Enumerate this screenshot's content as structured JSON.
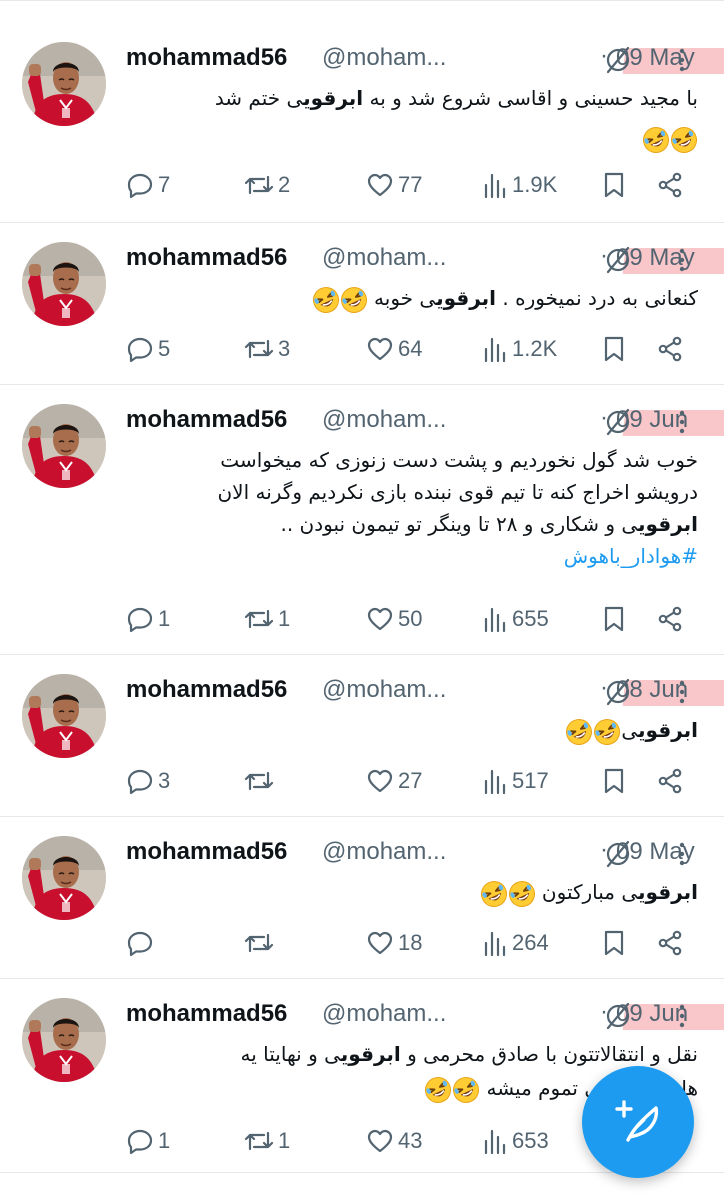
{
  "colors": {
    "accent": "#1d9bf0",
    "text": "#0f1419",
    "muted": "#536471",
    "highlight": "#f7b4b8"
  },
  "tweets": [
    {
      "name": "mohammad56",
      "handle": "@moham...",
      "date": "09 May",
      "highlighted": true,
      "lines": [
        {
          "parts": [
            {
              "t": "با مجید حسینی و اقاسی شروع شد و به "
            },
            {
              "t": "ابرقوی",
              "b": true
            },
            {
              "t": "ی ختم شد"
            }
          ]
        },
        {
          "parts": [],
          "emojis": 2
        }
      ],
      "replies": "7",
      "reposts": "2",
      "likes": "77",
      "views": "1.9K"
    },
    {
      "name": "mohammad56",
      "handle": "@moham...",
      "date": "09 May",
      "highlighted": true,
      "lines": [
        {
          "parts": [
            {
              "t": "کنعانی به درد نمیخوره . "
            },
            {
              "t": "ابرقوی",
              "b": true
            },
            {
              "t": "ی خوبه "
            }
          ],
          "emojis": 2
        }
      ],
      "replies": "5",
      "reposts": "3",
      "likes": "64",
      "views": "1.2K"
    },
    {
      "name": "mohammad56",
      "handle": "@moham...",
      "date": "09 Jun",
      "highlighted": true,
      "lines": [
        {
          "parts": [
            {
              "t": "خوب شد گول نخوردیم و پشت دست زنوزی که میخواست"
            }
          ]
        },
        {
          "parts": [
            {
              "t": "درویشو اخراج کنه تا تیم قوی نبنده بازی نکردیم وگرنه الان"
            }
          ]
        },
        {
          "parts": [
            {
              "t": "ابرقوی",
              "b": true
            },
            {
              "t": "ی و شکاری و ۲۸ تا وینگر تو تیمون نبودن .."
            }
          ]
        }
      ],
      "hashtag": "#هوادار_باهوش",
      "replies": "1",
      "reposts": "1",
      "likes": "50",
      "views": "655"
    },
    {
      "name": "mohammad56",
      "handle": "@moham...",
      "date": "08 Jun",
      "highlighted": true,
      "lines": [
        {
          "parts": [
            {
              "t": "ابرقوی",
              "b": true
            },
            {
              "t": "ی"
            }
          ],
          "emojis": 2
        }
      ],
      "replies": "3",
      "reposts": "",
      "likes": "27",
      "views": "517"
    },
    {
      "name": "mohammad56",
      "handle": "@moham...",
      "date": "09 May",
      "highlighted": false,
      "lines": [
        {
          "parts": [
            {
              "t": "ابرقوی",
              "b": true
            },
            {
              "t": "ی مبارکتون "
            }
          ],
          "emojis": 2
        }
      ],
      "replies": "",
      "reposts": "",
      "likes": "18",
      "views": "264"
    },
    {
      "name": "mohammad56",
      "handle": "@moham...",
      "date": "09 Jun",
      "highlighted": true,
      "lines": [
        {
          "parts": [
            {
              "t": "نقل و انتقالاتتون با صادق محرمی و "
            },
            {
              "t": "ابرقوی",
              "b": true
            },
            {
              "t": "ی و نهایتا یه"
            }
          ]
        },
        {
          "parts": [
            {
              "t": "هافبک خارجی تموم میشه "
            }
          ],
          "emojis": 2
        }
      ],
      "replies": "1",
      "reposts": "1",
      "likes": "43",
      "views": "653"
    }
  ],
  "icons": {
    "reply": "reply-icon",
    "repost": "repost-icon",
    "like": "heart-icon",
    "views": "views-icon",
    "bookmark": "bookmark-icon",
    "share": "share-icon",
    "grok": "slash-circle-icon",
    "more": "more-vertical-icon",
    "compose": "compose-post-icon"
  }
}
